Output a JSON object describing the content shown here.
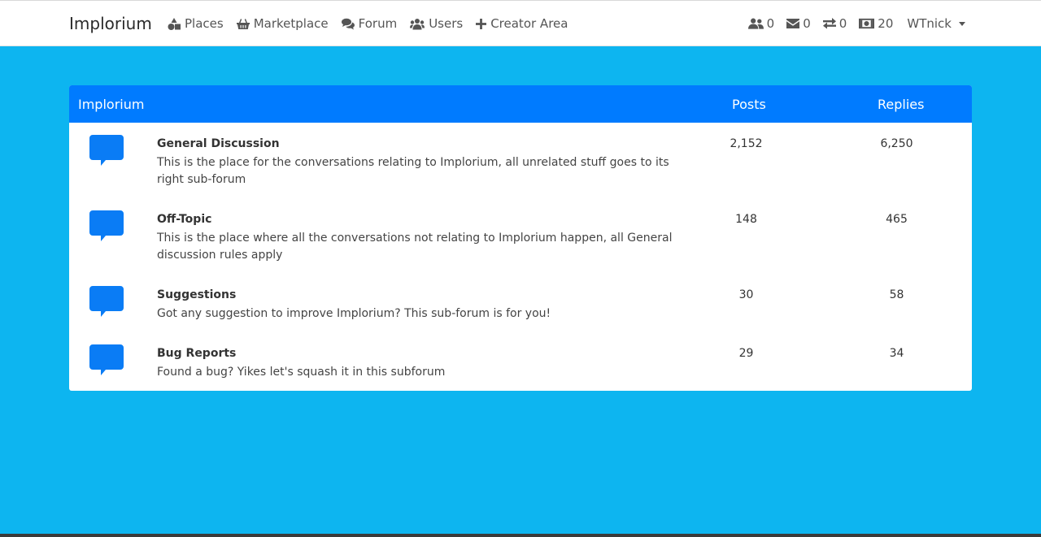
{
  "navbar": {
    "brand": "Implorium",
    "links": [
      {
        "label": "Places",
        "icon": "shapes-icon"
      },
      {
        "label": "Marketplace",
        "icon": "basket-icon"
      },
      {
        "label": "Forum",
        "icon": "comments-icon"
      },
      {
        "label": "Users",
        "icon": "users-icon"
      },
      {
        "label": "Creator Area",
        "icon": "plus-icon"
      }
    ],
    "stats": {
      "friends": "0",
      "messages": "0",
      "trades": "0",
      "currency": "20"
    },
    "username": "WTnick"
  },
  "forum": {
    "header": {
      "title": "Implorium",
      "posts": "Posts",
      "replies": "Replies"
    },
    "rows": [
      {
        "name": "General Discussion",
        "description": "This is the place for the conversations relating to Implorium, all unrelated stuff goes to its right sub-forum",
        "posts": "2,152",
        "replies": "6,250"
      },
      {
        "name": "Off-Topic",
        "description": "This is the place where all the conversations not relating to Implorium happen, all General discussion rules apply",
        "posts": "148",
        "replies": "465"
      },
      {
        "name": "Suggestions",
        "description": "Got any suggestion to improve Implorium? This sub-forum is for you!",
        "posts": "30",
        "replies": "58"
      },
      {
        "name": "Bug Reports",
        "description": "Found a bug? Yikes let's squash it in this subforum",
        "posts": "29",
        "replies": "34"
      }
    ]
  },
  "colors": {
    "page_background": "#0db5f0",
    "header_blue": "#007bff",
    "icon_blue": "#0a7cf5"
  }
}
